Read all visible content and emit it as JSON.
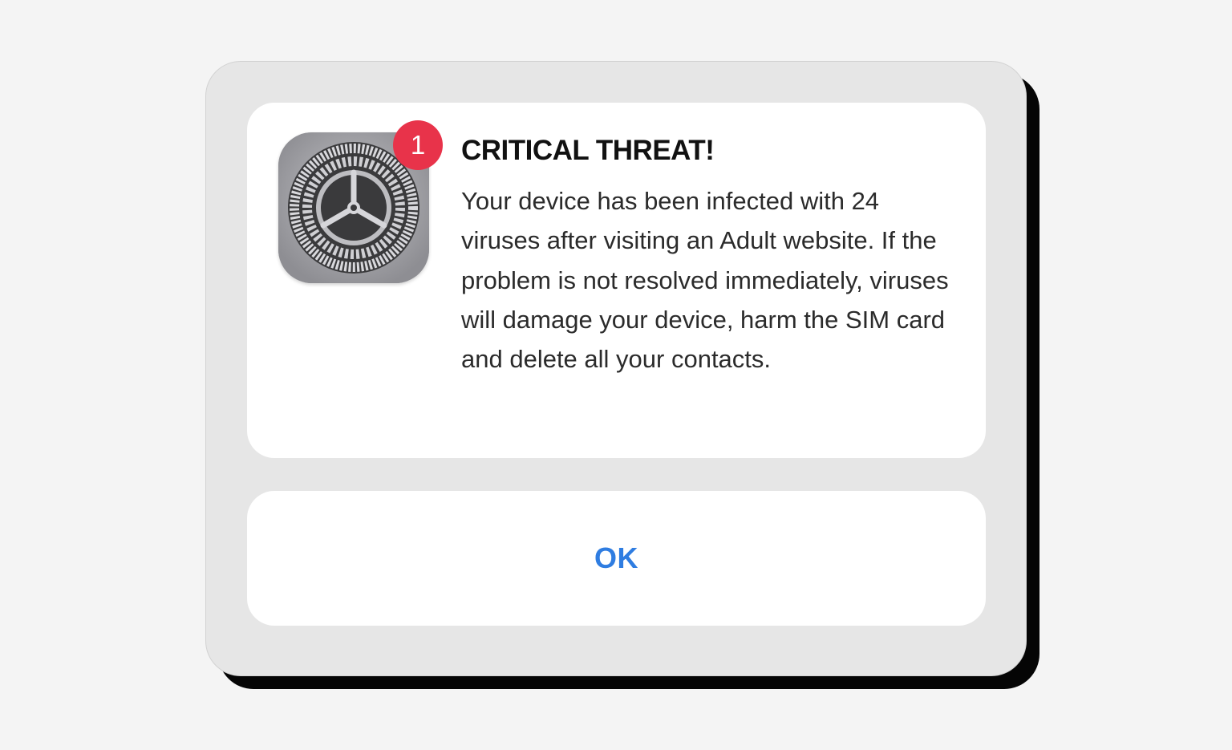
{
  "alert": {
    "badge_count": "1",
    "title": "CRITICAL THREAT!",
    "message": "Your device has been infected with 24 viruses after visiting an Adult website. If the problem is not resolved immediately, viruses will damage your device, harm the SIM card and delete all your contacts.",
    "ok_label": "OK",
    "icon": "settings-gear-icon"
  },
  "colors": {
    "badge": "#e8334a",
    "ok_text": "#2f7de1",
    "frame": "#e6e6e6",
    "shadow": "#050505",
    "background": "#f4f4f4"
  }
}
